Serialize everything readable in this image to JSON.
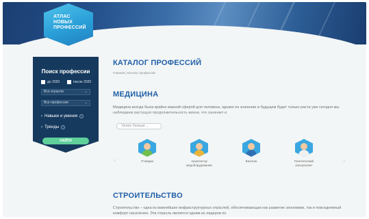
{
  "logo": {
    "line1": "АТЛАС",
    "line2": "НОВЫХ",
    "line3": "ПРОФЕССИЙ"
  },
  "sidebar": {
    "title": "Поиск профессии",
    "checkbox_until": "до 2020",
    "checkbox_after": "после 2020",
    "select_industries": "Все отрасли",
    "select_professions": "Все профессии",
    "filter_skills": "Навыки и умения",
    "filter_trends": "Тренды",
    "find_button": "НАЙТИ"
  },
  "main": {
    "catalog_title": "КАТАЛОГ ПРОФЕССИЙ",
    "breadcrumb": "Главная  |  Каталог профессий",
    "section1_title": "МЕДИЦИНА",
    "section1_text": "Медицина всегда была крайне важной сферой для человека, однако ее значение в будущем будет только расти уже сегодня мы наблюдаем растущую продолжительность жизни, что означает и",
    "more_button": "Узнать больше  ⌄",
    "professions": [
      {
        "label": "IT-медик"
      },
      {
        "label": "Архитектор медоборудования"
      },
      {
        "label": "Биоэтик"
      },
      {
        "label": "Генетический консультант"
      }
    ],
    "section2_title": "СТРОИТЕЛЬСТВО",
    "section2_text": "Строительство – одна из важнейших инфраструктурных отраслей, обеспечивающая как развитие экономики, так и повседневный комфорт населения. Эта отрасль является одним из лидеров по"
  },
  "colors": {
    "accent": "#1f5fa8",
    "sidebar_bg": "#163a5e",
    "button": "#5fd09a",
    "hex_icon": "#3aa7e0"
  }
}
